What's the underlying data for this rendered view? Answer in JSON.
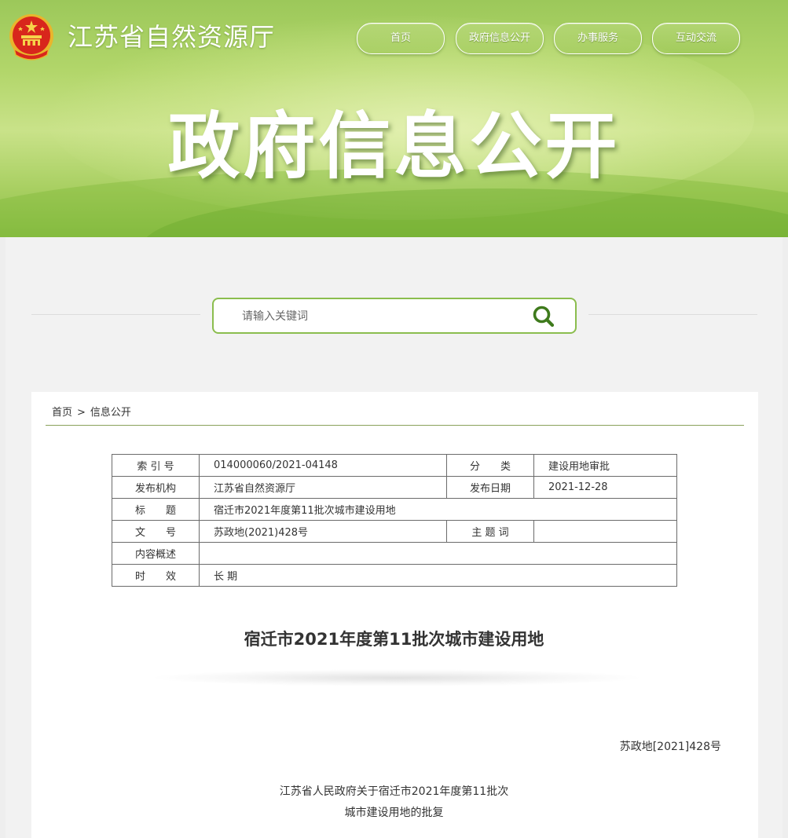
{
  "header": {
    "site_title": "江苏省自然资源厅",
    "hero_title": "政府信息公开",
    "nav": [
      {
        "label": "首页"
      },
      {
        "label": "政府信息公开"
      },
      {
        "label": "办事服务"
      },
      {
        "label": "互动交流"
      }
    ]
  },
  "search": {
    "placeholder": "请输入关键词"
  },
  "breadcrumb": {
    "home": "首页",
    "separator": ">",
    "current": "信息公开"
  },
  "meta": {
    "index_label": "索 引 号",
    "index_value": "014000060/2021-04148",
    "category_label": "分　　类",
    "category_value": "建设用地审批",
    "publisher_label": "发布机构",
    "publisher_value": "江苏省自然资源厅",
    "date_label": "发布日期",
    "date_value": "2021-12-28",
    "title_label": "标　　题",
    "title_value": "宿迁市2021年度第11批次城市建设用地",
    "docno_label": "文　　号",
    "docno_value": "苏政地(2021)428号",
    "keywords_label": "主 题 词",
    "keywords_value": "",
    "summary_label": "内容概述",
    "summary_value": "",
    "validity_label": "时　　效",
    "validity_value": "长 期"
  },
  "document": {
    "title": "宿迁市2021年度第11批次城市建设用地",
    "number": "苏政地[2021]428号",
    "heading_line1": "江苏省人民政府关于宿迁市2021年度第11批次",
    "heading_line2": "城市建设用地的批复"
  },
  "colors": {
    "accent_green": "#8bbd4e",
    "search_icon": "#3e7a1c",
    "emblem_red": "#d8261c",
    "emblem_gold": "#f3c23a"
  }
}
